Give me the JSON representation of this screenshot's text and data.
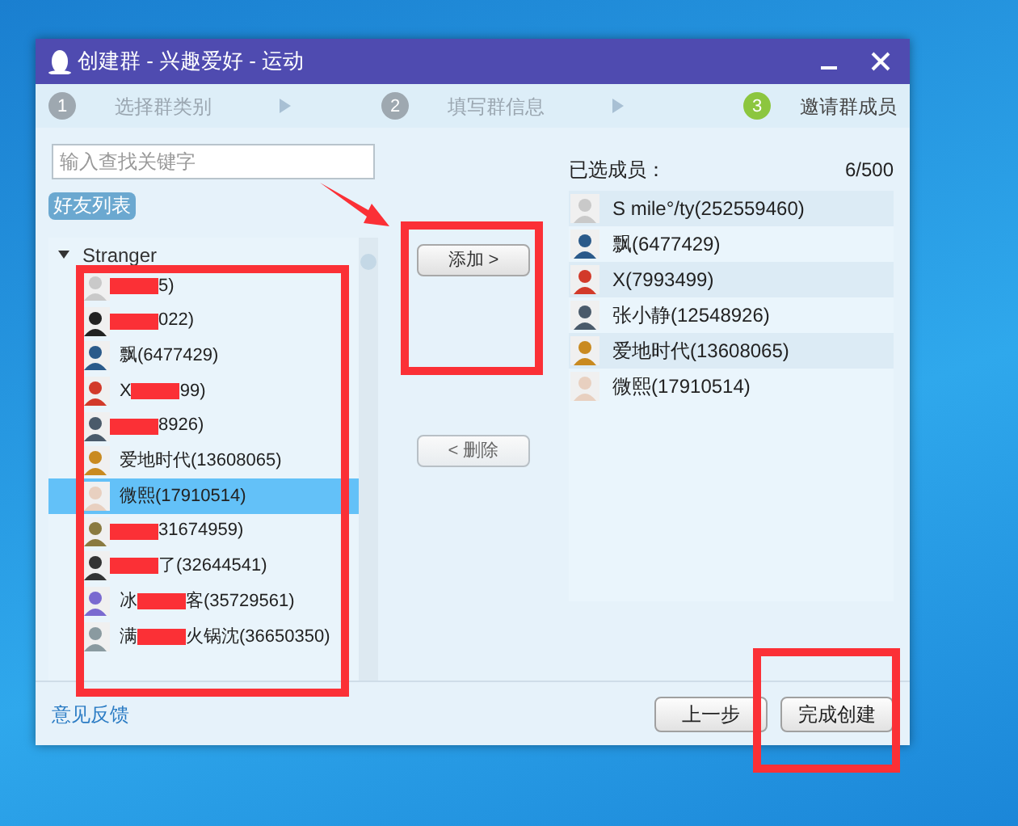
{
  "window": {
    "title": "创建群 - 兴趣爱好 - 运动"
  },
  "steps": [
    {
      "number": "1",
      "label": "选择群类别",
      "selected": false
    },
    {
      "number": "2",
      "label": "填写群信息",
      "selected": false
    },
    {
      "number": "3",
      "label": "邀请群成员",
      "selected": true
    }
  ],
  "search": {
    "placeholder": "输入查找关键字"
  },
  "friends_tab": {
    "label": "好友列表"
  },
  "friend_group": {
    "label": "Stranger",
    "expanded": true,
    "members": [
      {
        "suffix": "5)",
        "redacted": true,
        "selected": false
      },
      {
        "suffix": "022)",
        "redacted": true,
        "selected": false
      },
      {
        "prefix": "飘(6477429)",
        "redacted": false,
        "selected": false
      },
      {
        "prefix": "X",
        "suffix": "99)",
        "redacted": true,
        "selected": false
      },
      {
        "suffix": "8926)",
        "redacted": true,
        "selected": false
      },
      {
        "prefix": "爱地时代(13608065)",
        "redacted": false,
        "selected": false
      },
      {
        "prefix": "微熙(17910514)",
        "redacted": false,
        "selected": true
      },
      {
        "suffix": "31674959)",
        "redacted": true,
        "selected": false
      },
      {
        "suffix": "了(32644541)",
        "redacted": true,
        "selected": false
      },
      {
        "prefix": "冰",
        "suffix": "客(35729561)",
        "redacted": true,
        "selected": false
      },
      {
        "prefix": "满",
        "suffix": "火锅沈(36650350)",
        "redacted": true,
        "selected": false
      }
    ]
  },
  "add_button": {
    "label": "添加 >"
  },
  "delete_button": {
    "label": "< 删除"
  },
  "selected_members": {
    "label": "已选成员：",
    "count": "6/500",
    "members": [
      {
        "name": "S mile°/ty(252559460)"
      },
      {
        "name": "飘(6477429)"
      },
      {
        "name": "X(7993499)"
      },
      {
        "name": "张小静(12548926)"
      },
      {
        "name": "爱地时代(13608065)"
      },
      {
        "name": "微熙(17910514)"
      }
    ]
  },
  "feedback_link": {
    "label": "意见反馈"
  },
  "buttons": [
    {
      "label": "上一步"
    },
    {
      "label": "完成创建"
    }
  ]
}
